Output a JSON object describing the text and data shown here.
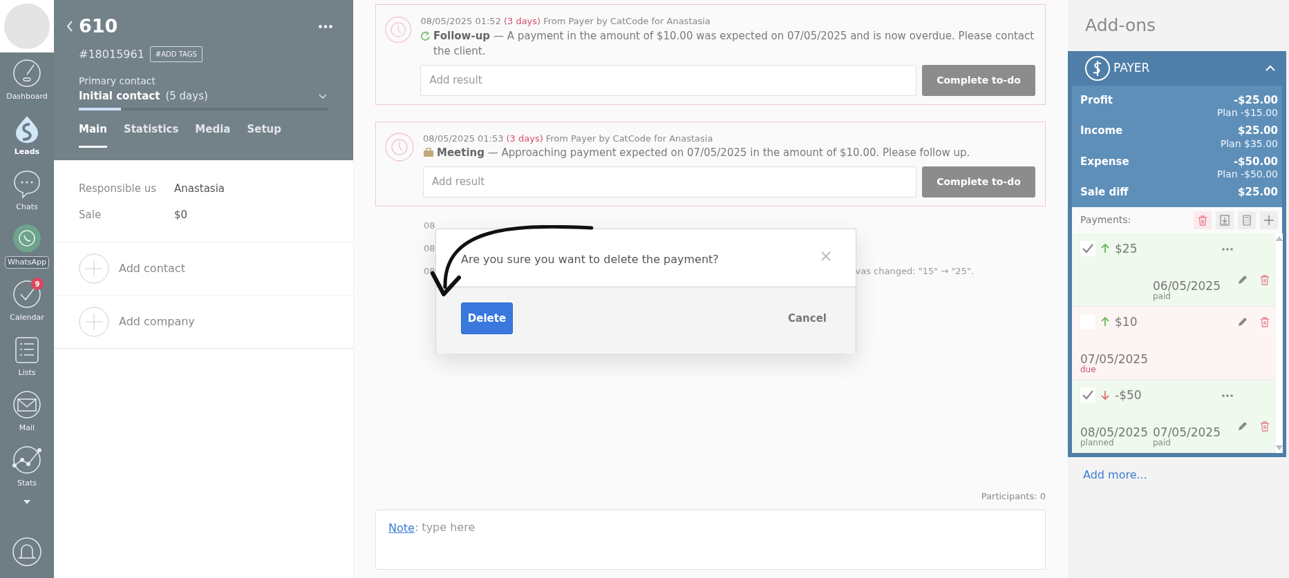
{
  "nav": {
    "items": [
      {
        "label": "Dashboard",
        "selected": false
      },
      {
        "label": "Leads",
        "selected": true
      },
      {
        "label": "Chats",
        "selected": false
      },
      {
        "label": "WhatsApp",
        "selected": false
      },
      {
        "label": "Calendar",
        "selected": false,
        "badge": "9"
      },
      {
        "label": "Lists",
        "selected": false
      },
      {
        "label": "Mail",
        "selected": false
      },
      {
        "label": "Stats",
        "selected": false
      }
    ]
  },
  "lead": {
    "title": "610",
    "id": "#18015961",
    "tags_button": "#ADD TAGS",
    "pipeline": "Primary contact",
    "stage": "Initial contact",
    "stage_duration": "(5 days)",
    "level": 0.17,
    "tabs": [
      {
        "label": "Main",
        "selected": true
      },
      {
        "label": "Statistics",
        "selected": false
      },
      {
        "label": "Media",
        "selected": false
      },
      {
        "label": "Setup",
        "selected": false
      }
    ],
    "fields": [
      {
        "label": "Responsible us",
        "value": "Anastasia"
      },
      {
        "label": "Sale",
        "value": "$0"
      }
    ],
    "add_links": [
      "Add contact",
      "Add company"
    ]
  },
  "tasks": [
    {
      "kind": "followup",
      "date": "08/05/2025 01:52",
      "overdue": "(3 days)",
      "source": "From Payer by CatCode for Anastasia",
      "text": "**Follow-up** — A payment in the amount of $10.00 was expected on 07/05/2025 and is now overdue. Please contact the client.",
      "placeholder": "Add result",
      "button": "Complete to-do"
    },
    {
      "kind": "meeting",
      "date": "08/05/2025 01:53",
      "overdue": "(3 days)",
      "source": "From Payer by CatCode for Anastasia",
      "text": "**Meeting** — Approaching payment expected on 07/05/2025 in the amount of $10.00. Please follow up.",
      "placeholder": "Add result",
      "button": "Complete to-do"
    }
  ],
  "log": [
    {
      "start": "08"
    },
    {
      "start": "08"
    },
    {
      "start": "08",
      "tail": "vas changed: \"15\" → \"25\"."
    }
  ],
  "participants": "Participants: 0",
  "note": {
    "link": "Note",
    "placeholder": ": type here"
  },
  "modal": {
    "message": "Are you sure you want to delete the payment?",
    "confirm": "Delete",
    "cancel": "Cancel"
  },
  "addons": {
    "title": "Add-ons",
    "add_more": "Add more...",
    "payer": {
      "name": "PAYER",
      "expanded": true,
      "summary": [
        {
          "label": "Profit",
          "value": "-$25.00",
          "plan": "Plan -$15.00"
        },
        {
          "label": "Income",
          "value": "$25.00",
          "plan": "Plan $35.00"
        },
        {
          "label": "Expense",
          "value": "-$50.00",
          "plan": "Plan -$50.00"
        },
        {
          "label": "Sale diff",
          "value": "$25.00"
        }
      ],
      "payments_label": "Payments:",
      "payments": [
        {
          "kind": "paid",
          "checked": true,
          "incoming": true,
          "amount": "$25",
          "menu": true,
          "dates": [
            {
              "date": "06/05/2025",
              "status": "paid"
            }
          ]
        },
        {
          "kind": "due",
          "checked": false,
          "incoming": true,
          "amount": "$10",
          "menu": false,
          "dates": [
            {
              "date": "07/05/2025",
              "status": "due"
            }
          ]
        },
        {
          "kind": "paid",
          "checked": true,
          "incoming": false,
          "amount": "-$50",
          "menu": true,
          "dates": [
            {
              "date": "08/05/2025",
              "status": "planned"
            },
            {
              "date": "07/05/2025",
              "status": "paid"
            }
          ]
        }
      ]
    }
  }
}
